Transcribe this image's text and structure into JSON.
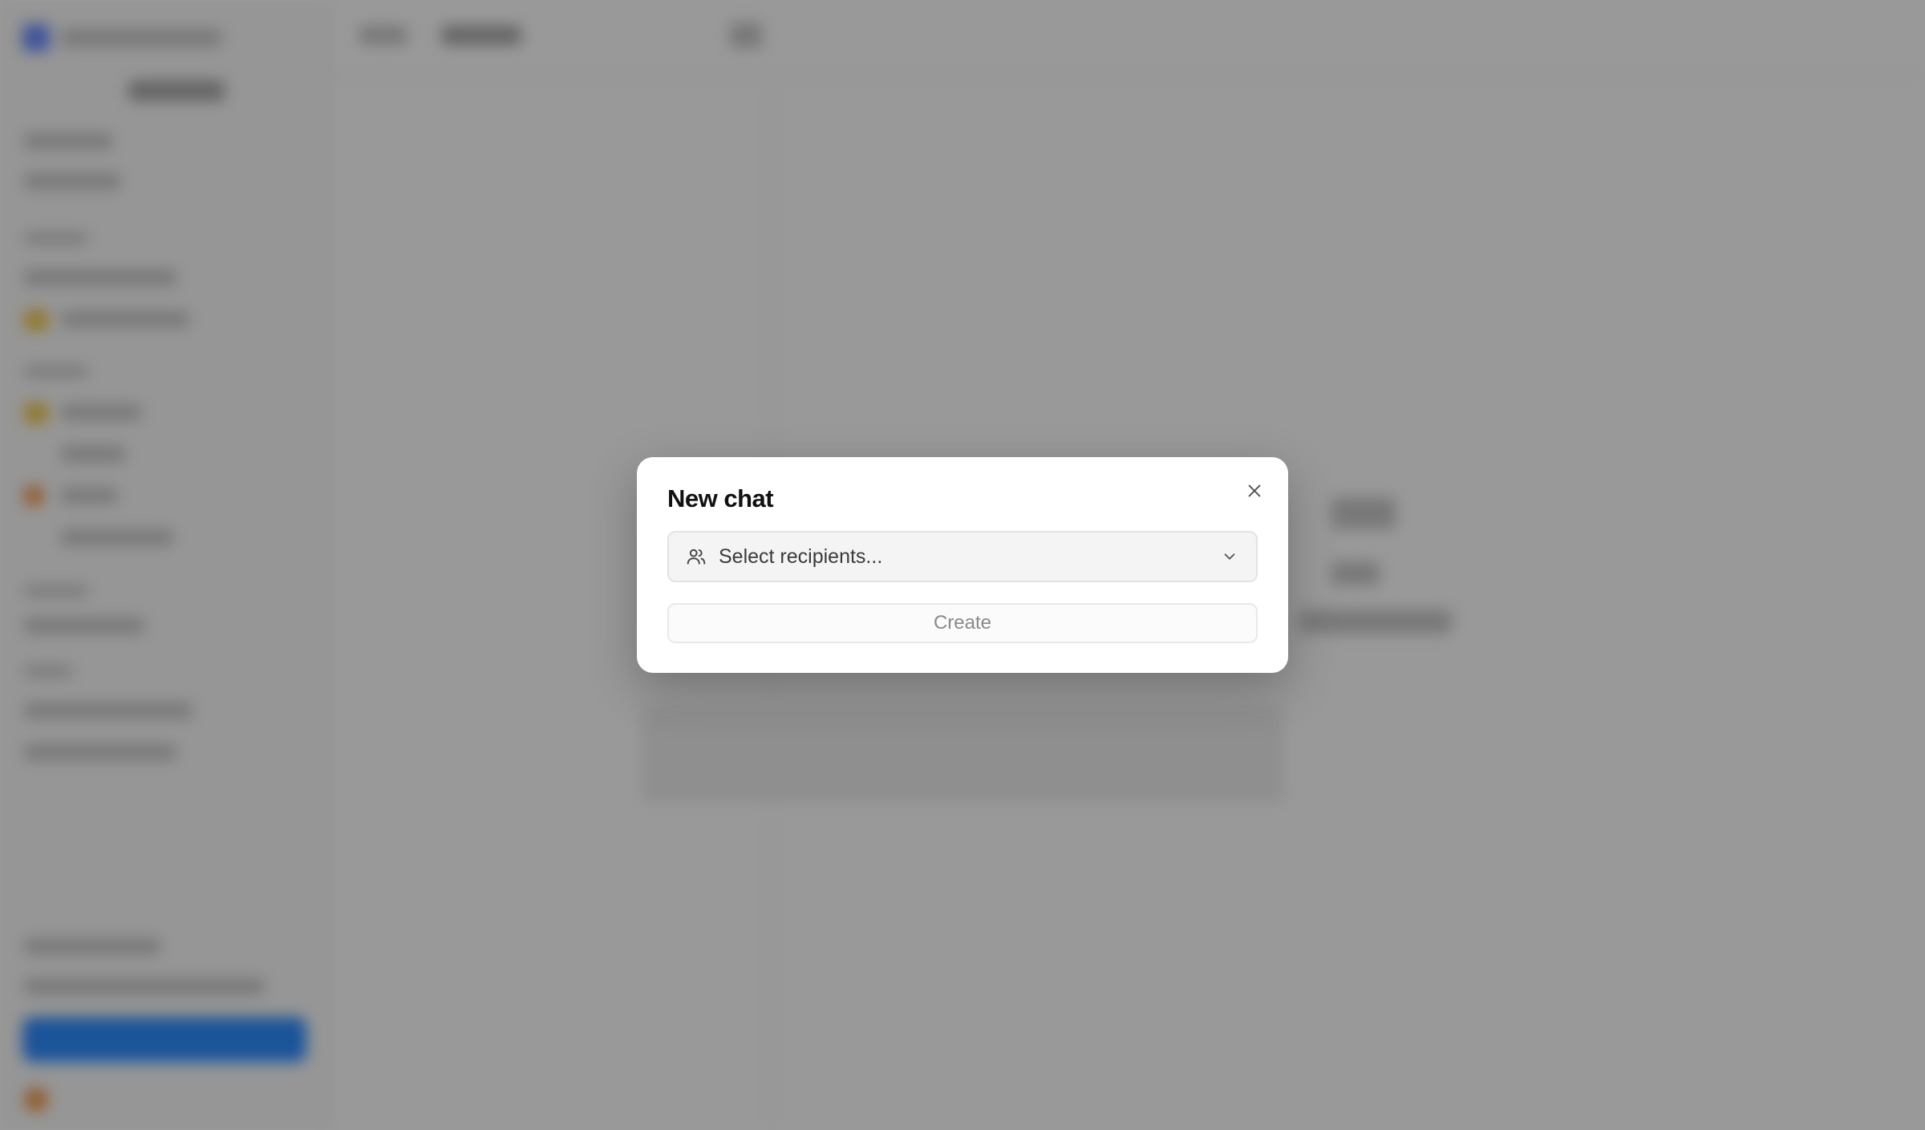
{
  "dialog": {
    "title": "New chat",
    "recipients_placeholder": "Select recipients...",
    "create_label": "Create",
    "create_disabled": true
  },
  "icons": {
    "close": "close-icon",
    "recipients": "users-icon",
    "dropdown": "chevron-down-icon"
  },
  "colors": {
    "overlay": "#9a9a9a",
    "dialog_bg": "#ffffff",
    "select_bg": "#f4f4f5",
    "create_text_disabled": "#8a8a8d",
    "accent_blue": "#2d8cff"
  }
}
